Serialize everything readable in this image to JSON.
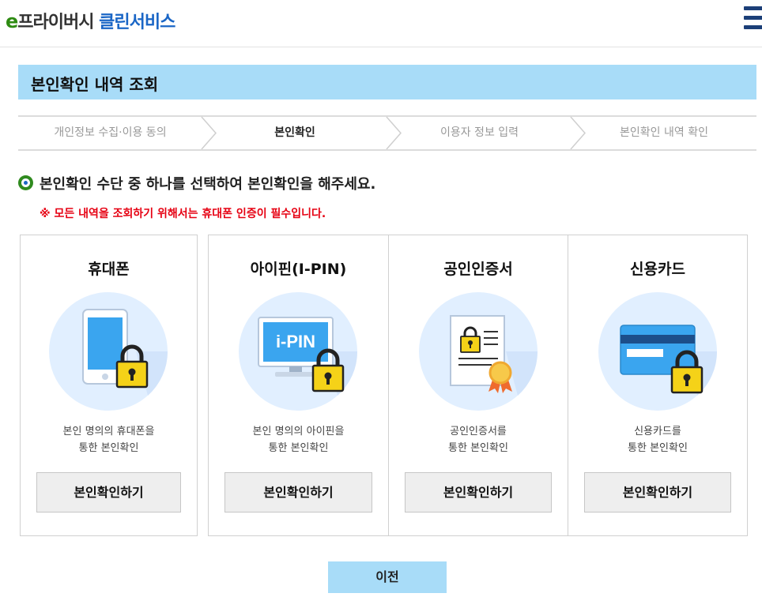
{
  "header": {
    "logo_e": "e",
    "logo_privacy": "프라이버시",
    "logo_clean": "클린서비스",
    "menu_icon": "hamburger-menu-icon"
  },
  "page_title": "본인확인 내역 조회",
  "steps": [
    {
      "label": "개인정보 수집·이용 동의",
      "active": false
    },
    {
      "label": "본인확인",
      "active": true
    },
    {
      "label": "이용자 정보 입력",
      "active": false
    },
    {
      "label": "본인확인 내역 확인",
      "active": false
    }
  ],
  "guide_text": "본인확인 수단 중 하나를 선택하여 본인확인을 해주세요.",
  "warning_text": "※ 모든 내역을 조회하기 위해서는 휴대폰 인증이 필수입니다.",
  "methods": [
    {
      "title": "휴대폰",
      "desc_line1": "본인 명의의 휴대폰을",
      "desc_line2": "통한 본인확인",
      "button": "본인확인하기",
      "icon": "smartphone-lock-icon"
    },
    {
      "title": "아이핀(I-PIN)",
      "desc_line1": "본인 명의의 아이핀을",
      "desc_line2": "통한 본인확인",
      "button": "본인확인하기",
      "icon": "ipin-monitor-lock-icon",
      "icon_text": "i-PIN"
    },
    {
      "title": "공인인증서",
      "desc_line1": "공인인증서를",
      "desc_line2": "통한 본인확인",
      "button": "본인확인하기",
      "icon": "certificate-icon"
    },
    {
      "title": "신용카드",
      "desc_line1": "신용카드를",
      "desc_line2": "통한 본인확인",
      "button": "본인확인하기",
      "icon": "credit-card-lock-icon"
    }
  ],
  "prev_button": "이전",
  "colors": {
    "accent_light_blue": "#a8dcf8",
    "logo_green": "#2e8b12",
    "logo_blue": "#1a66c6",
    "warning_red": "#e60012",
    "lock_yellow": "#f5d218"
  }
}
